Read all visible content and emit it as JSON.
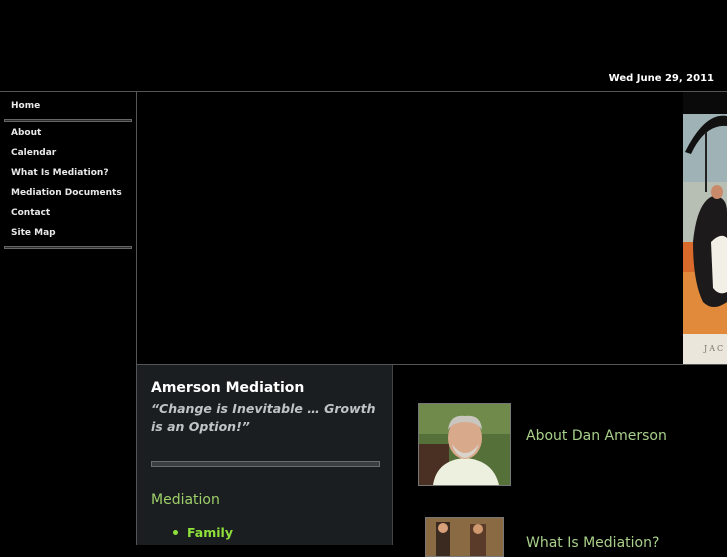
{
  "header": {
    "date": "Wed June 29, 2011"
  },
  "sidebar": {
    "items": [
      {
        "label": "Home"
      },
      {
        "label": "About"
      },
      {
        "label": "Calendar"
      },
      {
        "label": "What Is Mediation?"
      },
      {
        "label": "Mediation Documents"
      },
      {
        "label": "Contact"
      },
      {
        "label": "Site Map"
      }
    ]
  },
  "banner": {
    "caption_fragment": "JAC"
  },
  "main": {
    "title": "Amerson Mediation",
    "tagline": "“Change is Inevitable … Growth is an Option!”",
    "section_heading": "Mediation",
    "list": [
      {
        "label": "Family"
      }
    ]
  },
  "features": [
    {
      "label": "About Dan Amerson"
    },
    {
      "label": "What Is Mediation?"
    }
  ],
  "colors": {
    "background": "#000000",
    "panel": "#1b1e20",
    "link_green": "#a9d08a",
    "bullet_green": "#8ee03a"
  }
}
